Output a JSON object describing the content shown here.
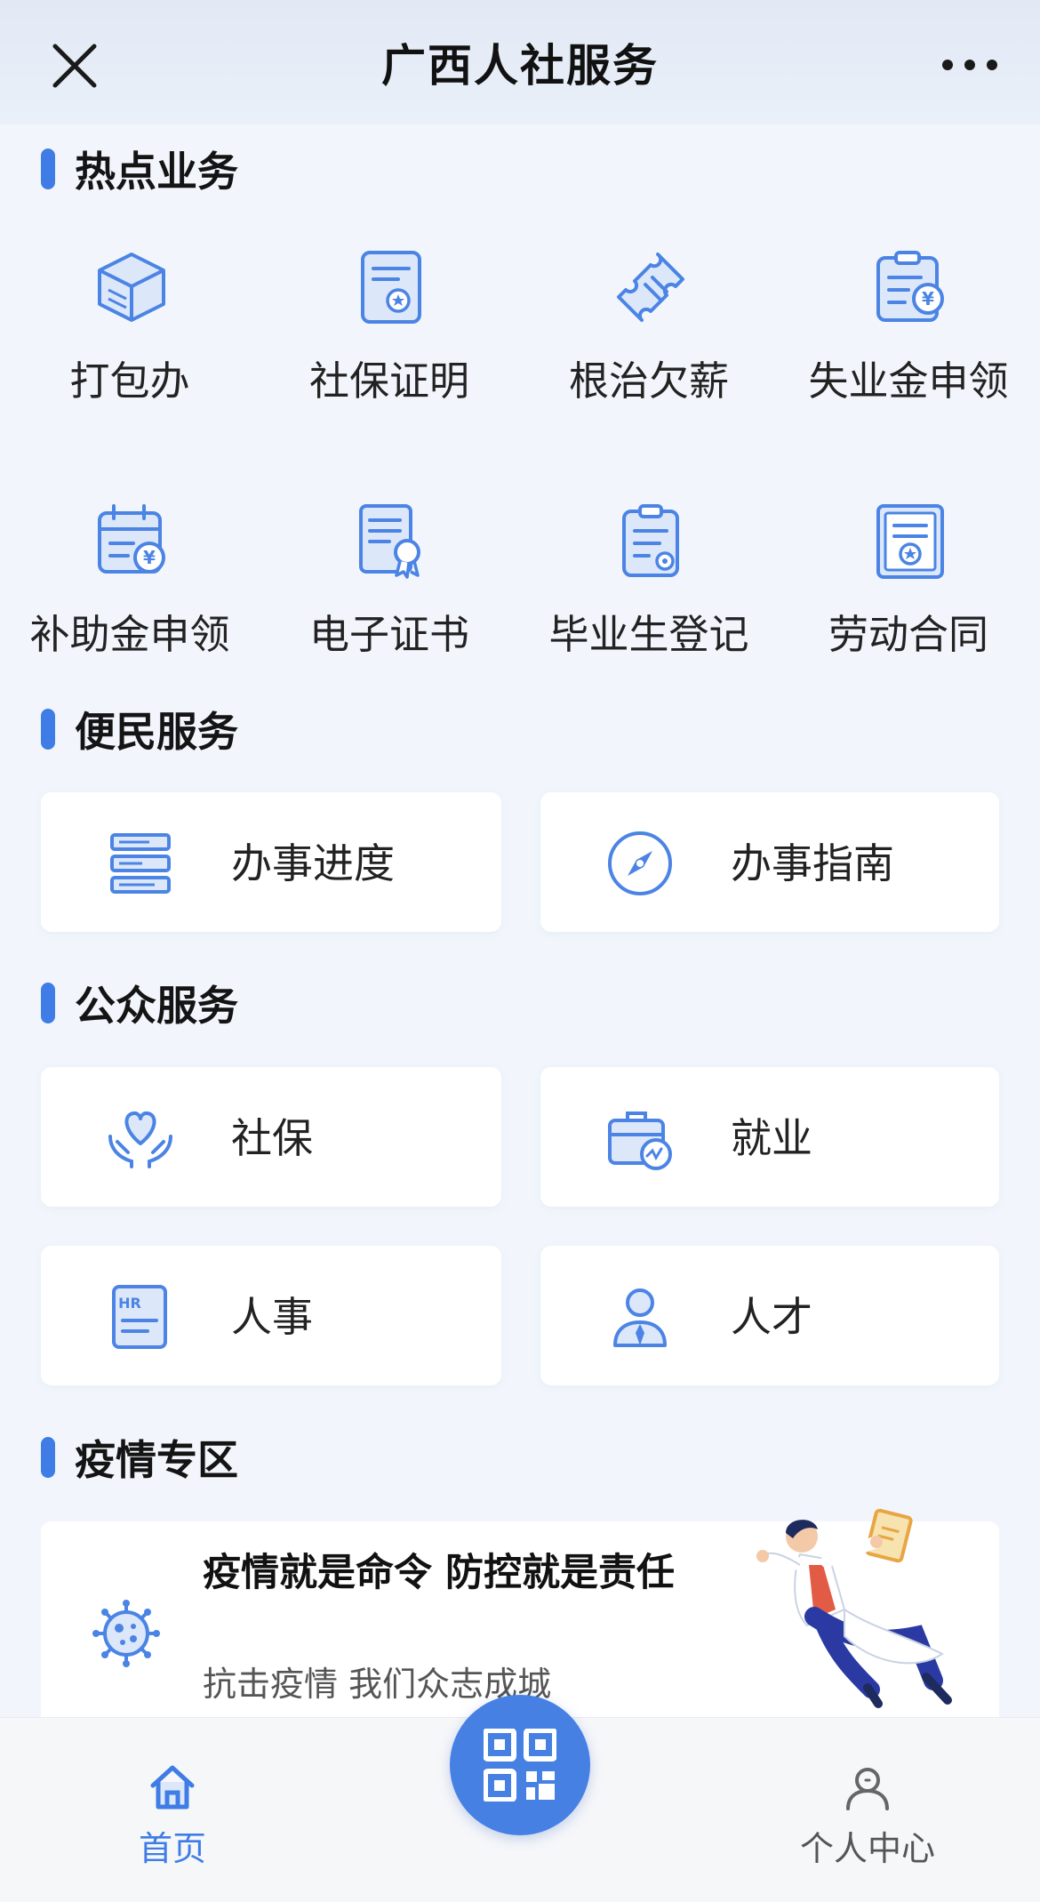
{
  "header": {
    "title": "广西人社服务",
    "close_icon": "close-icon",
    "more_icon": "more-icon"
  },
  "accent_color": "#3f7ce6",
  "hot": {
    "title": "热点业务",
    "items": [
      {
        "label": "打包办",
        "icon": "box-stack-icon"
      },
      {
        "label": "社保证明",
        "icon": "certificate-doc-icon"
      },
      {
        "label": "根治欠薪",
        "icon": "ticket-icon"
      },
      {
        "label": "失业金申领",
        "icon": "clipboard-money-icon"
      },
      {
        "label": "补助金申领",
        "icon": "calendar-money-icon"
      },
      {
        "label": "电子证书",
        "icon": "award-doc-icon"
      },
      {
        "label": "毕业生登记",
        "icon": "clipboard-gear-icon"
      },
      {
        "label": "劳动合同",
        "icon": "contract-star-icon"
      }
    ]
  },
  "convenience": {
    "title": "便民服务",
    "items": [
      {
        "label": "办事进度",
        "icon": "progress-list-icon"
      },
      {
        "label": "办事指南",
        "icon": "compass-icon"
      }
    ]
  },
  "public": {
    "title": "公众服务",
    "items": [
      {
        "label": "社保",
        "icon": "heart-hands-icon"
      },
      {
        "label": "就业",
        "icon": "briefcase-icon"
      },
      {
        "label": "人事",
        "icon": "hr-doc-icon"
      },
      {
        "label": "人才",
        "icon": "person-tie-icon"
      }
    ]
  },
  "epidemic": {
    "title": "疫情专区",
    "banner_title": "疫情就是命令 防控就是责任",
    "banner_subtitle": "抗击疫情 我们众志成城",
    "icon": "virus-icon"
  },
  "tabbar": {
    "home_label": "首页",
    "me_label": "个人中心",
    "scan_icon": "qr-code-icon"
  }
}
